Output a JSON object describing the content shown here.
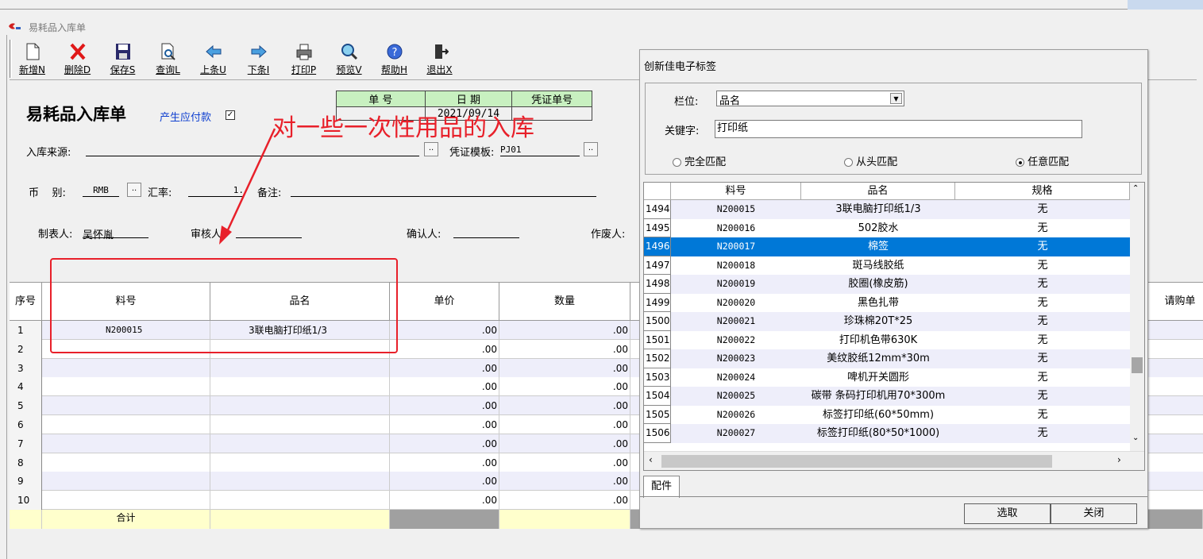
{
  "window": {
    "title": "易耗品入库单"
  },
  "toolbar": [
    {
      "label": "新增N",
      "icon": "new-doc-icon"
    },
    {
      "label": "删除D",
      "icon": "delete-x-icon"
    },
    {
      "label": "保存S",
      "icon": "save-disk-icon"
    },
    {
      "label": "查询L",
      "icon": "search-doc-icon"
    },
    {
      "label": "上条U",
      "icon": "arrow-left-icon"
    },
    {
      "label": "下条I",
      "icon": "arrow-right-icon"
    },
    {
      "label": "打印P",
      "icon": "printer-icon"
    },
    {
      "label": "预览V",
      "icon": "preview-magnifier-icon"
    },
    {
      "label": "帮助H",
      "icon": "help-icon"
    },
    {
      "label": "退出X",
      "icon": "exit-door-icon"
    }
  ],
  "form": {
    "title": "易耗品入库单",
    "payable_label": "产生应付款",
    "payable_checked": "✓",
    "voucher_table": {
      "col_no": "单  号",
      "col_date": "日  期",
      "col_voucher": "凭证单号",
      "no": "",
      "date": "2021/09/14",
      "voucher": ""
    },
    "source_label": "入库来源:",
    "source_value": "",
    "template_label": "凭证模板:",
    "template_value": "PJ01",
    "currency_label": "币    别:",
    "currency_value": "RMB",
    "rate_label": "汇率:",
    "rate_value": "1.",
    "note_label": "备注:",
    "note_value": "",
    "maker_label": "制表人:",
    "maker_value": "吴怀胤",
    "auditor_label": "审核人:",
    "auditor_value": "",
    "confirm_label": "确认人:",
    "confirm_value": "",
    "void_label": "作废人:"
  },
  "annotation": {
    "text": "对一些一次性用品的入库"
  },
  "grid": {
    "headers": [
      "序号",
      "料号",
      "品名",
      "单价",
      "数量",
      "请购单"
    ],
    "rows": [
      {
        "no": "1",
        "part": "N200015",
        "name": "3联电脑打印纸1/3",
        "price": ".00",
        "qty": ".00"
      },
      {
        "no": "2",
        "part": "",
        "name": "",
        "price": ".00",
        "qty": ".00"
      },
      {
        "no": "3",
        "part": "",
        "name": "",
        "price": ".00",
        "qty": ".00"
      },
      {
        "no": "4",
        "part": "",
        "name": "",
        "price": ".00",
        "qty": ".00"
      },
      {
        "no": "5",
        "part": "",
        "name": "",
        "price": ".00",
        "qty": ".00"
      },
      {
        "no": "6",
        "part": "",
        "name": "",
        "price": ".00",
        "qty": ".00"
      },
      {
        "no": "7",
        "part": "",
        "name": "",
        "price": ".00",
        "qty": ".00"
      },
      {
        "no": "8",
        "part": "",
        "name": "",
        "price": ".00",
        "qty": ".00"
      },
      {
        "no": "9",
        "part": "",
        "name": "",
        "price": ".00",
        "qty": ".00"
      },
      {
        "no": "10",
        "part": "",
        "name": "",
        "price": ".00",
        "qty": ".00"
      }
    ],
    "total_label": "合计"
  },
  "dialog": {
    "title": "创新佳电子标签",
    "field_label": "栏位:",
    "field_value": "品名",
    "keyword_label": "关键字:",
    "keyword_value": "打印纸",
    "match_options": [
      "完全匹配",
      "从头匹配",
      "任意匹配"
    ],
    "match_selected": "任意匹配",
    "list_headers": [
      "料号",
      "品名",
      "规格"
    ],
    "list_rows": [
      {
        "rn": "1494",
        "part": "N200015",
        "name": "3联电脑打印纸1/3",
        "spec": "无"
      },
      {
        "rn": "1495",
        "part": "N200016",
        "name": "502胶水",
        "spec": "无"
      },
      {
        "rn": "1496",
        "part": "N200017",
        "name": "棉签",
        "spec": "无",
        "selected": true
      },
      {
        "rn": "1497",
        "part": "N200018",
        "name": "斑马线胶纸",
        "spec": "无"
      },
      {
        "rn": "1498",
        "part": "N200019",
        "name": "胶圈(橡皮筋)",
        "spec": "无"
      },
      {
        "rn": "1499",
        "part": "N200020",
        "name": "黑色扎带",
        "spec": "无"
      },
      {
        "rn": "1500",
        "part": "N200021",
        "name": "珍珠棉20T*25",
        "spec": "无"
      },
      {
        "rn": "1501",
        "part": "N200022",
        "name": "打印机色带630K",
        "spec": "无"
      },
      {
        "rn": "1502",
        "part": "N200023",
        "name": "美纹胶纸12mm*30m",
        "spec": "无"
      },
      {
        "rn": "1503",
        "part": "N200024",
        "name": "啤机开关圆形",
        "spec": "无"
      },
      {
        "rn": "1504",
        "part": "N200025",
        "name": "碳带 条码打印机用70*300m",
        "spec": "无"
      },
      {
        "rn": "1505",
        "part": "N200026",
        "name": "标签打印纸(60*50mm)",
        "spec": "无"
      },
      {
        "rn": "1506",
        "part": "N200027",
        "name": "标签打印纸(80*50*1000)",
        "spec": "无"
      }
    ],
    "tab_label": "配件",
    "select_button": "选取",
    "close_button": "关闭"
  },
  "colors": {
    "selection": "#0078d7",
    "annotation": "#e8202a",
    "row_alt": "#eeeefa",
    "total_row": "#ffffcc",
    "link_blue": "#1040d0"
  }
}
